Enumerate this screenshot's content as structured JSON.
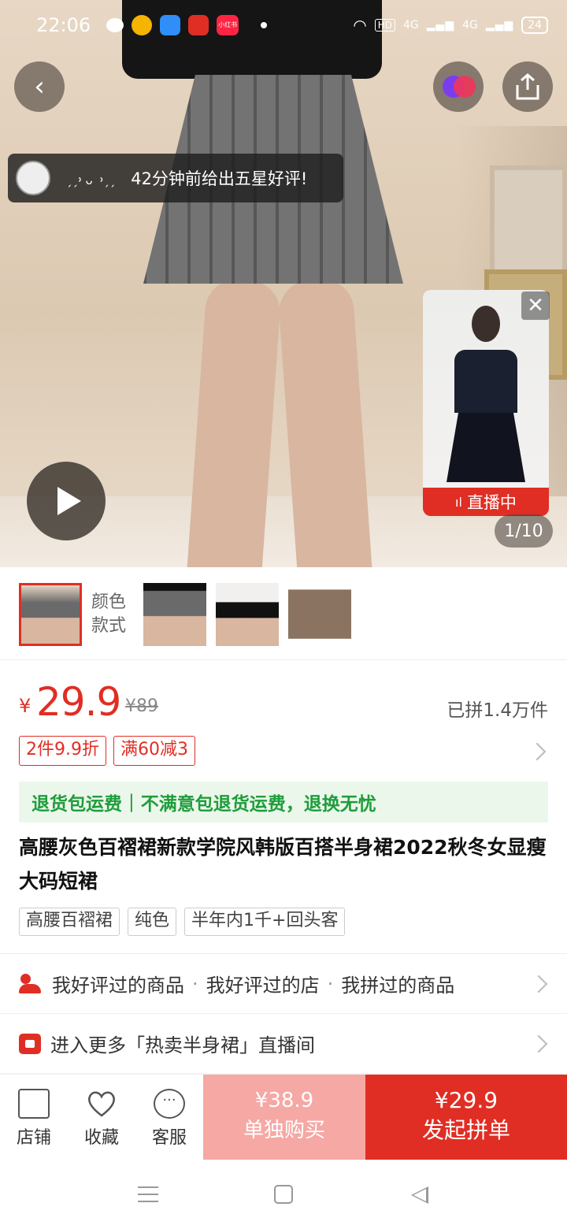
{
  "status_bar": {
    "time": "22:06",
    "app_icons": [
      "wechat-icon",
      "weibo-icon",
      "qq-browser-icon",
      "pinduoduo-icon",
      "xiaohongshu-icon"
    ],
    "xiaohongshu_label": "小红书",
    "network": [
      "wifi-icon",
      "HD",
      "4G",
      "4G"
    ],
    "battery": "24"
  },
  "hero": {
    "review_toast": {
      "nickname": "ˏˏ᠈ ᴗ ᠈ˏˏ",
      "text": "42分钟前给出五星好评!"
    },
    "live_card": {
      "label": "直播中"
    },
    "image_counter": "1/10"
  },
  "variants": {
    "label": "颜色款式",
    "count_shown": 4
  },
  "price": {
    "currency": "¥",
    "current": "29.9",
    "original": "¥89",
    "sold": "已拼1.4万件"
  },
  "discount_tags": [
    "2件9.9折",
    "满60减3"
  ],
  "guarantee": {
    "left": "退货包运费",
    "separator": "|",
    "right": "不满意包退货运费，退换无忧"
  },
  "product_title": "高腰灰色百褶裙新款学院风韩版百搭半身裙2022秋冬女显瘦大码短裙",
  "feature_chips": [
    "高腰百褶裙",
    "纯色",
    "半年内1千+回头客"
  ],
  "related": {
    "items": [
      "我好评过的商品",
      "我好评过的店",
      "我拼过的商品"
    ],
    "separator": "·"
  },
  "live_entry": "进入更多「热卖半身裙」直播间",
  "action_bar": {
    "store": "店铺",
    "favorite": "收藏",
    "service": "客服",
    "single_price": "¥38.9",
    "single_label": "单独购买",
    "group_price": "¥29.9",
    "group_label": "发起拼单"
  },
  "colors": {
    "accent": "#e02e24",
    "single_buy_bg": "#f6a8a4",
    "guarantee_green": "#1f9d3b",
    "guarantee_bg": "#ecf7ec"
  }
}
